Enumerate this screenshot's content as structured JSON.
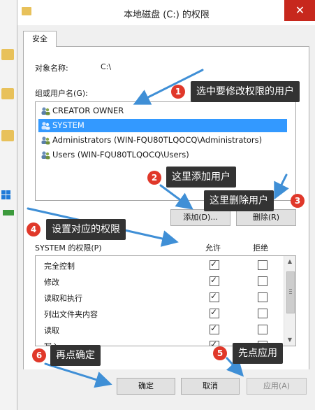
{
  "window": {
    "title": "本地磁盘 (C:) 的权限",
    "close_glyph": "✕"
  },
  "tab": {
    "label": "安全"
  },
  "object": {
    "label": "对象名称:",
    "value": "C:\\"
  },
  "groups": {
    "label": "组或用户名(G):",
    "items": [
      {
        "name": "CREATOR OWNER",
        "selected": false
      },
      {
        "name": "SYSTEM",
        "selected": true
      },
      {
        "name": "Administrators (WIN-FQU80TLQOCQ\\Administrators)",
        "selected": false
      },
      {
        "name": "Users (WIN-FQU80TLQOCQ\\Users)",
        "selected": false
      }
    ]
  },
  "buttons": {
    "add": "添加(D)...",
    "remove": "删除(R)",
    "ok": "确定",
    "cancel": "取消",
    "apply": "应用(A)"
  },
  "permissions": {
    "label": "SYSTEM 的权限(P)",
    "allow_header": "允许",
    "deny_header": "拒绝",
    "rows": [
      {
        "name": "完全控制",
        "allow": true,
        "deny": false
      },
      {
        "name": "修改",
        "allow": true,
        "deny": false
      },
      {
        "name": "读取和执行",
        "allow": true,
        "deny": false
      },
      {
        "name": "列出文件夹内容",
        "allow": true,
        "deny": false
      },
      {
        "name": "读取",
        "allow": true,
        "deny": false
      },
      {
        "name": "写入",
        "allow": true,
        "deny": false
      }
    ]
  },
  "annotations": [
    {
      "num": "1",
      "text": "选中要修改权限的用户"
    },
    {
      "num": "2",
      "text": "这里添加用户"
    },
    {
      "num": "3",
      "text": "这里删除用户"
    },
    {
      "num": "4",
      "text": "设置对应的权限"
    },
    {
      "num": "5",
      "text": "先点应用"
    },
    {
      "num": "6",
      "text": "再点确定"
    }
  ],
  "colors": {
    "selection": "#3399ff",
    "close": "#c7281d",
    "badge": "#e0382a",
    "arrow": "#3f8fd6"
  }
}
